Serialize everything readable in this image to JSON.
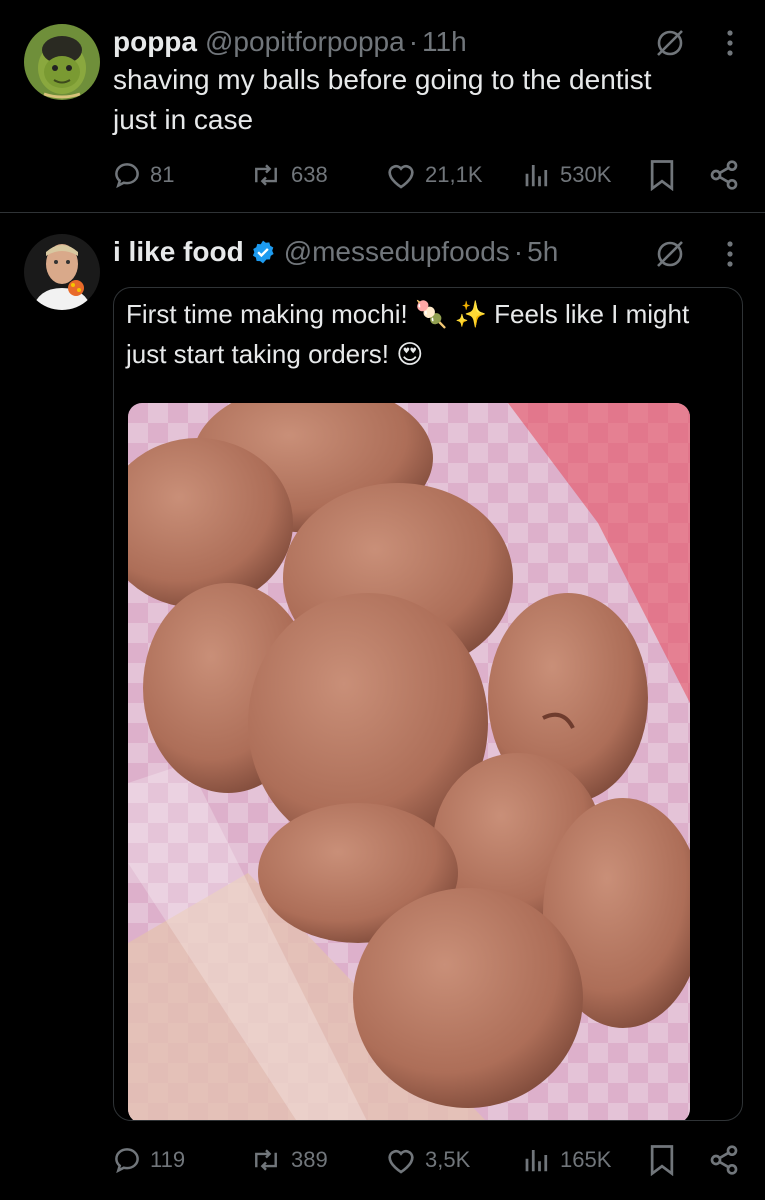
{
  "tweets": [
    {
      "name": "poppa",
      "handle": "@popitforpoppa",
      "separator": "·",
      "time": "11h",
      "text_line1": "shaving my balls before going to the dentist",
      "text_line2": "just in case",
      "replies": "81",
      "retweets": "638",
      "likes": "21,1K",
      "views": "530K"
    },
    {
      "name": "i like food",
      "handle": "@messedupfoods",
      "separator": "·",
      "time": "5h",
      "quote_line1": "First time making mochi! 🍡 ✨ Feels like I might",
      "quote_line2": "just start taking orders! 😍",
      "replies": "119",
      "retweets": "389",
      "likes": "3,5K",
      "views": "165K"
    }
  ],
  "colors": {
    "background": "#000000",
    "text": "#e7e9ea",
    "muted": "#71767b",
    "border": "#2f3336",
    "verified": "#1d9bf0"
  },
  "icons": [
    "reply-icon",
    "retweet-icon",
    "like-icon",
    "views-icon",
    "bookmark-icon",
    "share-icon",
    "grok-icon",
    "more-icon",
    "verified-badge-icon"
  ]
}
